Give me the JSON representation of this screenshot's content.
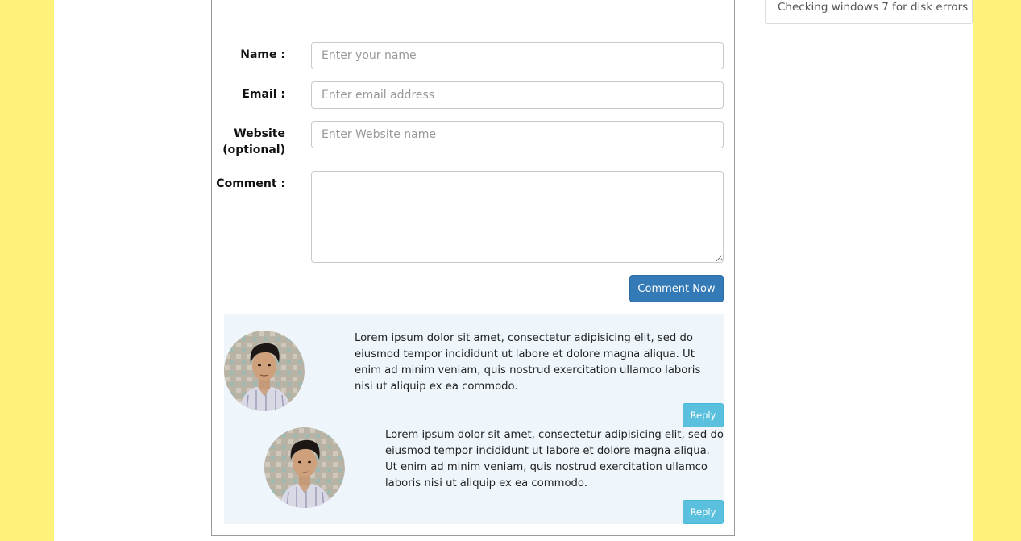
{
  "form": {
    "name_label": "Name :",
    "name_placeholder": "Enter your name",
    "email_label": "Email :",
    "email_placeholder": "Enter email address",
    "website_label_line1": "Website",
    "website_label_line2": "(optional)",
    "website_placeholder": "Enter Website name",
    "comment_label": "Comment :",
    "comment_value": "",
    "submit_label": "Comment Now"
  },
  "comments": [
    {
      "text": "Lorem ipsum dolor sit amet, consectetur adipisicing elit, sed do eiusmod tempor incididunt ut labore et dolore magna aliqua. Ut enim ad minim veniam, quis nostrud exercitation ullamco laboris nisi ut aliquip ex ea commodo.",
      "reply_label": "Reply"
    },
    {
      "text": "Lorem ipsum dolor sit amet, consectetur adipisicing elit, sed do eiusmod tempor incididunt ut labore et dolore magna aliqua. Ut enim ad minim veniam, quis nostrud exercitation ullamco laboris nisi ut aliquip ex ea commodo.",
      "reply_label": "Reply"
    }
  ],
  "sidebar": {
    "link_label": "Checking windows 7 for disk errors"
  },
  "colors": {
    "page_background": "#fff27a",
    "primary_button": "#337ab7",
    "reply_button": "#5bc0de",
    "comments_background": "#eef6fc"
  }
}
